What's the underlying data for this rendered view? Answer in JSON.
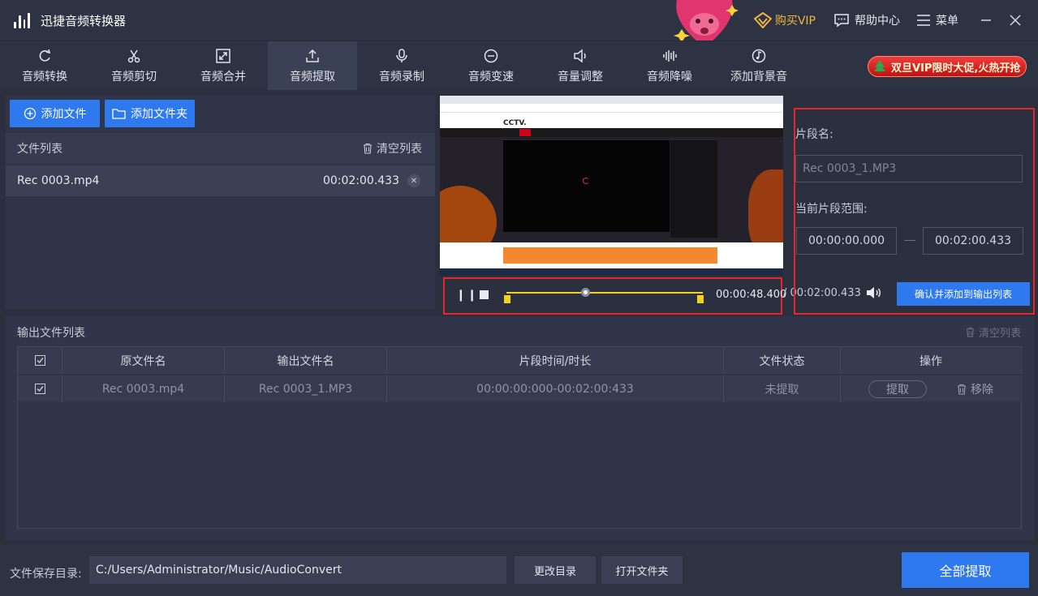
{
  "app": {
    "title": "迅捷音频转换器"
  },
  "titlebar": {
    "vip": "购买VIP",
    "help": "帮助中心",
    "menu": "菜单"
  },
  "nav": {
    "tabs": [
      {
        "label": "音频转换",
        "icon": "refresh-icon"
      },
      {
        "label": "音频剪切",
        "icon": "scissors-icon"
      },
      {
        "label": "音频合并",
        "icon": "merge-icon"
      },
      {
        "label": "音频提取",
        "icon": "upload-icon",
        "active": true
      },
      {
        "label": "音频录制",
        "icon": "microphone-icon"
      },
      {
        "label": "音频变速",
        "icon": "speed-icon"
      },
      {
        "label": "音量调整",
        "icon": "volume-icon"
      },
      {
        "label": "音频降噪",
        "icon": "waveform-icon"
      },
      {
        "label": "添加背景音",
        "icon": "music-note-icon"
      }
    ],
    "promo": "双旦VIP限时大促,火热开抢"
  },
  "file_panel": {
    "add_file": "添加文件",
    "add_folder": "添加文件夹",
    "list_title": "文件列表",
    "clear_list": "清空列表",
    "files": [
      {
        "name": "Rec 0003.mp4",
        "duration": "00:02:00.433"
      }
    ]
  },
  "player": {
    "current_time": "00:00:48.400",
    "total_time": "/ 00:02:00.433",
    "progress": 0.402,
    "confirm": "确认并添加到输出列表"
  },
  "segment": {
    "name_label": "片段名:",
    "name_value": "Rec 0003_1.MP3",
    "range_label": "当前片段范围:",
    "start": "00:00:00.000",
    "end": "00:02:00.433"
  },
  "output": {
    "title": "输出文件列表",
    "clear": "清空列表",
    "headers": [
      "原文件名",
      "输出文件名",
      "片段时间/时长",
      "文件状态",
      "操作"
    ],
    "rows": [
      {
        "original": "Rec 0003.mp4",
        "output": "Rec 0003_1.MP3",
        "range": "00:00:00:000-00:02:00:433",
        "status": "未提取",
        "extract": "提取",
        "remove": "移除"
      }
    ]
  },
  "bottom": {
    "save_label": "文件保存目录:",
    "path": "C:/Users/Administrator/Music/AudioConvert",
    "change_dir": "更改目录",
    "open_folder": "打开文件夹",
    "extract_all": "全部提取"
  },
  "colors": {
    "accent": "#2f79ee",
    "highlight": "#e5262a",
    "track": "#f1d21a",
    "vip": "#f2b43c"
  }
}
